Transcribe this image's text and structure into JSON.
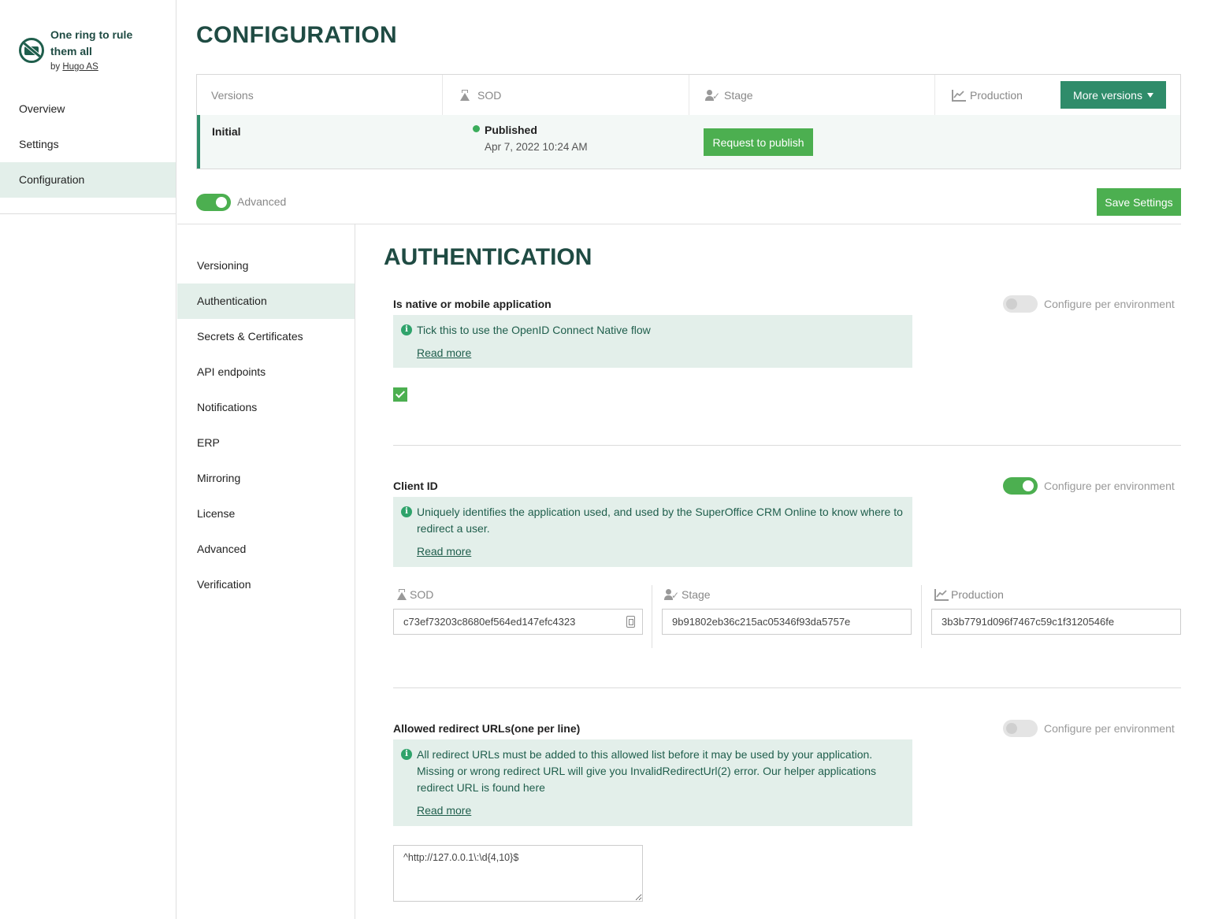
{
  "app": {
    "name": "One ring to rule them all",
    "by_prefix": "by",
    "author": "Hugo AS"
  },
  "app_nav": [
    {
      "label": "Overview",
      "active": false
    },
    {
      "label": "Settings",
      "active": false
    },
    {
      "label": "Configuration",
      "active": true
    }
  ],
  "page_title": "CONFIGURATION",
  "versions": {
    "headers": {
      "versions": "Versions",
      "sod": "SOD",
      "stage": "Stage",
      "production": "Production"
    },
    "more_versions_label": "More versions",
    "row": {
      "name": "Initial",
      "sod_status": "Published",
      "sod_date": "Apr 7, 2022 10:24 AM",
      "stage_action": "Request to publish"
    }
  },
  "advanced": {
    "label": "Advanced",
    "enabled": true
  },
  "save_label": "Save Settings",
  "sub_nav": [
    {
      "label": "Versioning",
      "active": false
    },
    {
      "label": "Authentication",
      "active": true
    },
    {
      "label": "Secrets & Certificates",
      "active": false
    },
    {
      "label": "API endpoints",
      "active": false
    },
    {
      "label": "Notifications",
      "active": false
    },
    {
      "label": "ERP",
      "active": false
    },
    {
      "label": "Mirroring",
      "active": false
    },
    {
      "label": "License",
      "active": false
    },
    {
      "label": "Advanced",
      "active": false
    },
    {
      "label": "Verification",
      "active": false
    }
  ],
  "section_title": "AUTHENTICATION",
  "configure_per_env_label": "Configure per environment",
  "read_more": "Read more",
  "fields": {
    "native": {
      "label": "Is native or mobile application",
      "info": "Tick this to use the OpenID Connect Native flow",
      "per_env": false,
      "checked": true
    },
    "client_id": {
      "label": "Client ID",
      "info": "Uniquely identifies the application used, and used by the SuperOffice CRM Online to know where to redirect a user.",
      "per_env": true,
      "env_labels": {
        "sod": "SOD",
        "stage": "Stage",
        "production": "Production"
      },
      "values": {
        "sod": "c73ef73203c8680ef564ed147efc4323",
        "stage": "9b91802eb36c215ac05346f93da5757e",
        "production": "3b3b7791d096f7467c59c1f3120546fe"
      }
    },
    "redirect_urls": {
      "label": "Allowed redirect URLs(one per line)",
      "info": "All redirect URLs must be added to this allowed list before it may be used by your application. Missing or wrong redirect URL will give you InvalidRedirectUrl(2) error. Our helper applications redirect URL is found here",
      "per_env": false,
      "value": "^http://127.0.0.1\\:\\d{4,10}$"
    }
  },
  "colors": {
    "brand_dark": "#1f4b43",
    "accent_green": "#4caf50",
    "teal": "#2f8c6a",
    "info_bg": "#e3efea"
  }
}
